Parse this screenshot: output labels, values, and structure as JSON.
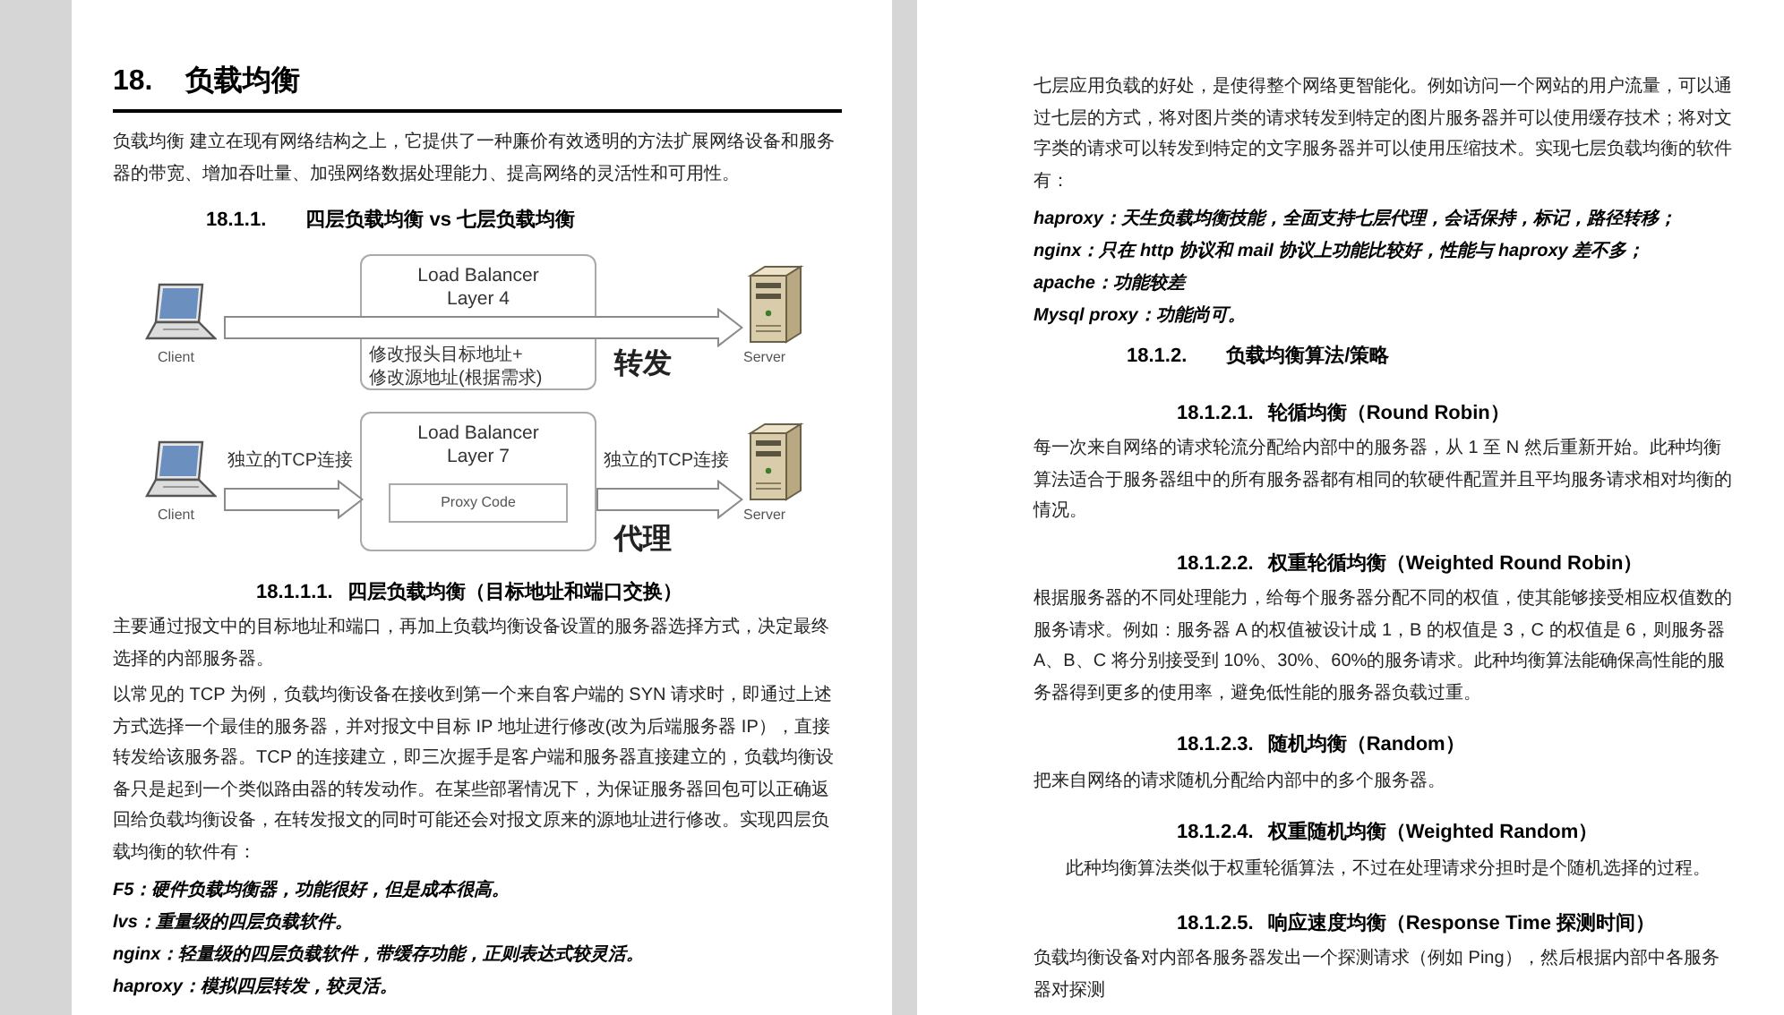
{
  "pages": [
    {
      "blocks": [
        {
          "kind": "h1",
          "number": "18.",
          "text": "负载均衡"
        },
        {
          "kind": "para",
          "text": "负载均衡 建立在现有网络结构之上，它提供了一种廉价有效透明的方法扩展网络设备和服务器的带宽、增加吞吐量、加强网络数据处理能力、提高网络的灵活性和可用性。"
        },
        {
          "kind": "h3",
          "number": "18.1.1.",
          "text": "四层负载均衡 vs 七层负载均衡"
        },
        {
          "kind": "diagram",
          "rows": [
            {
              "kind": "forward",
              "client": "Client",
              "server": "Server",
              "box_title": [
                "Load Balancer",
                "Layer 4"
              ],
              "notes": [
                "修改报头目标地址+",
                "修改源地址(根据需求)"
              ],
              "caption": "转发"
            },
            {
              "kind": "proxy",
              "client": "Client",
              "server": "Server",
              "box_title": [
                "Load Balancer",
                "Layer 7"
              ],
              "inner": "Proxy Code",
              "left_label": "独立的TCP连接",
              "right_label": "独立的TCP连接",
              "caption": "代理"
            }
          ]
        },
        {
          "kind": "h4",
          "number": "18.1.1.1.",
          "text": "四层负载均衡（目标地址和端口交换）"
        },
        {
          "kind": "para",
          "text": "主要通过报文中的目标地址和端口，再加上负载均衡设备设置的服务器选择方式，决定最终选择的内部服务器。"
        },
        {
          "kind": "para",
          "text": "以常见的 TCP 为例，负载均衡设备在接收到第一个来自客户端的 SYN 请求时，即通过上述方式选择一个最佳的服务器，并对报文中目标 IP 地址进行修改(改为后端服务器 IP），直接转发给该服务器。TCP 的连接建立，即三次握手是客户端和服务器直接建立的，负载均衡设备只是起到一个类似路由器的转发动作。在某些部署情况下，为保证服务器回包可以正确返回给负载均衡设备，在转发报文的同时可能还会对报文原来的源地址进行修改。实现四层负载均衡的软件有："
        },
        {
          "kind": "item",
          "text": "F5：硬件负载均衡器，功能很好，但是成本很高。"
        },
        {
          "kind": "item",
          "text": "lvs：重量级的四层负载软件。"
        },
        {
          "kind": "item",
          "text": "nginx：轻量级的四层负载软件，带缓存功能，正则表达式较灵活。"
        },
        {
          "kind": "item",
          "text": "haproxy：模拟四层转发，较灵活。"
        }
      ]
    },
    {
      "blocks": [
        {
          "kind": "para",
          "text": "七层应用负载的好处，是使得整个网络更智能化。例如访问一个网站的用户流量，可以通过七层的方式，将对图片类的请求转发到特定的图片服务器并可以使用缓存技术；将对文字类的请求可以转发到特定的文字服务器并可以使用压缩技术。实现七层负载均衡的软件有："
        },
        {
          "kind": "item",
          "text": "haproxy：天生负载均衡技能，全面支持七层代理，会话保持，标记，路径转移；"
        },
        {
          "kind": "item",
          "text": "nginx：只在 http 协议和 mail 协议上功能比较好，性能与 haproxy 差不多；"
        },
        {
          "kind": "item",
          "text": "apache：功能较差"
        },
        {
          "kind": "item",
          "text": "Mysql proxy：功能尚可。"
        },
        {
          "kind": "h3",
          "number": "18.1.2.",
          "text": "负载均衡算法/策略"
        },
        {
          "kind": "h4",
          "number": "18.1.2.1.",
          "text": "轮循均衡（Round Robin）"
        },
        {
          "kind": "para",
          "text": "每一次来自网络的请求轮流分配给内部中的服务器，从 1 至 N 然后重新开始。此种均衡算法适合于服务器组中的所有服务器都有相同的软硬件配置并且平均服务请求相对均衡的情况。"
        },
        {
          "kind": "h4",
          "number": "18.1.2.2.",
          "text": "权重轮循均衡（Weighted Round Robin）"
        },
        {
          "kind": "para",
          "text": "根据服务器的不同处理能力，给每个服务器分配不同的权值，使其能够接受相应权值数的服务请求。例如：服务器 A 的权值被设计成 1，B 的权值是 3，C 的权值是 6，则服务器 A、B、C 将分别接受到 10%、30%、60%的服务请求。此种均衡算法能确保高性能的服务器得到更多的使用率，避免低性能的服务器负载过重。"
        },
        {
          "kind": "h4",
          "number": "18.1.2.3.",
          "text": "随机均衡（Random）"
        },
        {
          "kind": "para",
          "text": "把来自网络的请求随机分配给内部中的多个服务器。"
        },
        {
          "kind": "h4",
          "number": "18.1.2.4.",
          "text": "权重随机均衡（Weighted Random）"
        },
        {
          "kind": "para_indented",
          "text": "此种均衡算法类似于权重轮循算法，不过在处理请求分担时是个随机选择的过程。"
        },
        {
          "kind": "h4",
          "number": "18.1.2.5.",
          "text": "响应速度均衡（Response Time 探测时间）"
        },
        {
          "kind": "para",
          "text": "负载均衡设备对内部各服务器发出一个探测请求（例如 Ping），然后根据内部中各服务器对探测"
        }
      ]
    }
  ]
}
